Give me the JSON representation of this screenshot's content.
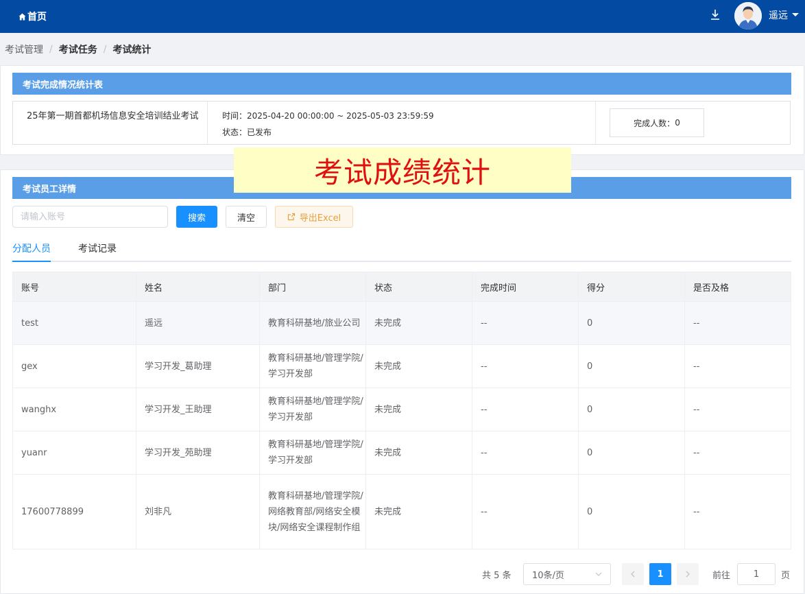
{
  "topbar": {
    "home_label": "首页",
    "username": "遥远"
  },
  "breadcrumb": [
    "考试管理",
    "考试任务",
    "考试统计"
  ],
  "summary": {
    "header": "考试完成情况统计表",
    "exam_name": "25年第一期首都机场信息安全培训结业考试",
    "time_label": "时间：",
    "time_value": "2025-04-20 00:00:00 ~ 2025-05-03 23:59:59",
    "status_label": "状态：",
    "status_value": "已发布",
    "completed_label": "完成人数：",
    "completed_value": "0"
  },
  "banner": "考试成绩统计",
  "detail": {
    "header": "考试员工详情",
    "search_placeholder": "请输入账号",
    "search_button": "搜索",
    "clear_button": "清空",
    "export_button": "导出Excel",
    "tabs": [
      "分配人员",
      "考试记录"
    ]
  },
  "table": {
    "columns": [
      "账号",
      "姓名",
      "部门",
      "状态",
      "完成时间",
      "得分",
      "是否及格"
    ],
    "rows": [
      [
        "test",
        "遥远",
        "教育科研基地/旅业公司",
        "未完成",
        "--",
        "0",
        "--"
      ],
      [
        "gex",
        "学习开发_葛助理",
        "教育科研基地/管理学院/学习开发部",
        "未完成",
        "--",
        "0",
        "--"
      ],
      [
        "wanghx",
        "学习开发_王助理",
        "教育科研基地/管理学院/学习开发部",
        "未完成",
        "--",
        "0",
        "--"
      ],
      [
        "yuanr",
        "学习开发_苑助理",
        "教育科研基地/管理学院/学习开发部",
        "未完成",
        "--",
        "0",
        "--"
      ],
      [
        "17600778899",
        "刘非凡",
        "教育科研基地/管理学院/网络教育部/网络安全模块/网络安全课程制作组",
        "未完成",
        "--",
        "0",
        "--"
      ]
    ]
  },
  "pagination": {
    "total": "共 5 条",
    "page_size": "10条/页",
    "current": "1",
    "goto_label": "前往",
    "goto_value": "1",
    "goto_unit": "页"
  }
}
